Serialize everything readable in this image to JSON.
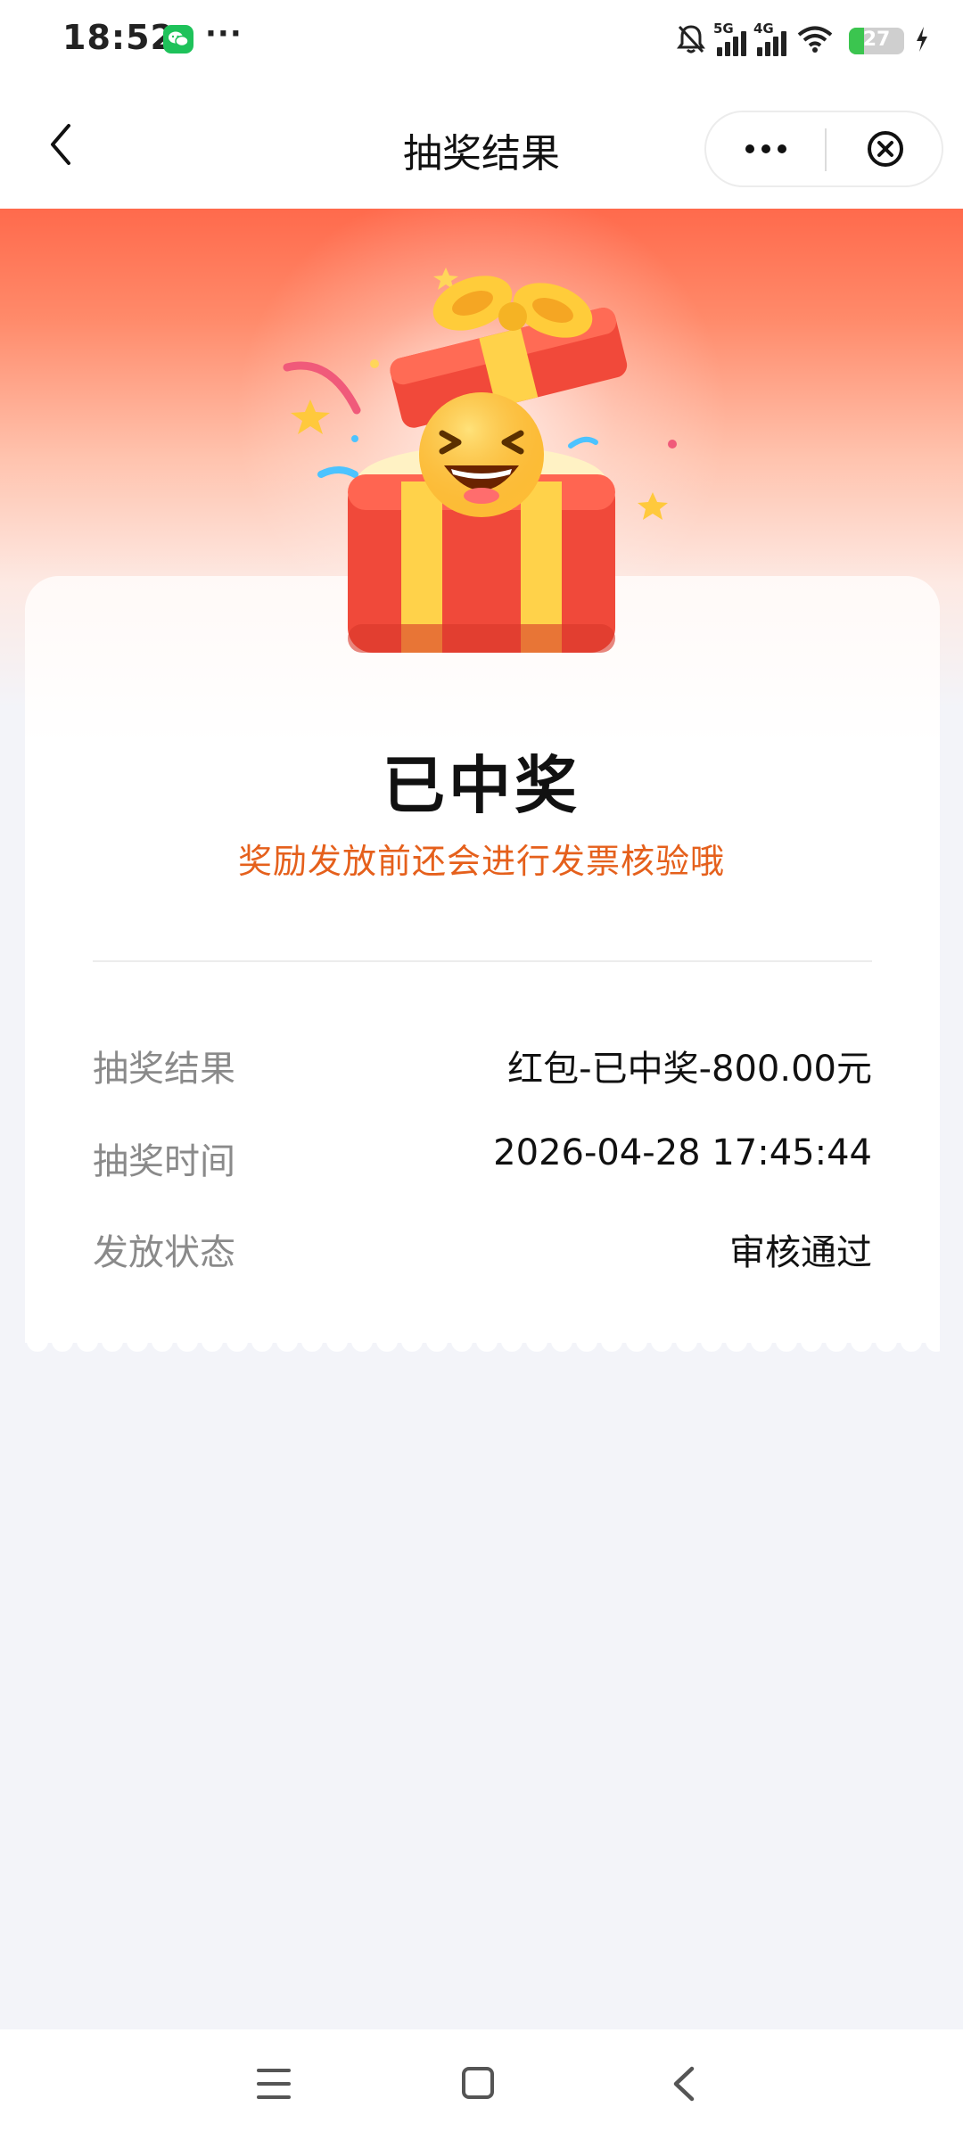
{
  "status_bar": {
    "time": "18:52",
    "more": "···",
    "signal_1_label": "5G",
    "signal_2_label": "4G",
    "battery": "27",
    "battery_level": 0.27,
    "icons": [
      "wechat-icon",
      "bell-off-icon",
      "signal-icon",
      "wifi-icon",
      "battery-icon",
      "charging-icon"
    ]
  },
  "nav": {
    "title": "抽奖结果",
    "back_icon": "chevron-left-icon",
    "more_icon": "more-dots-icon",
    "close_icon": "close-circle-icon"
  },
  "result": {
    "title": "已中奖",
    "subtitle": "奖励发放前还会进行发票核验哦",
    "image": "gift-box-emoji-illustration"
  },
  "details": [
    {
      "label": "抽奖结果",
      "value": "红包-已中奖-800.00元"
    },
    {
      "label": "抽奖时间",
      "value": "2026-04-28 17:45:44"
    },
    {
      "label": "发放状态",
      "value": "审核通过"
    }
  ],
  "system_nav": {
    "icons": [
      "menu-icon",
      "home-icon",
      "back-icon"
    ]
  },
  "colors": {
    "accent": "#e5601c",
    "hero_top": "#ff6a4c",
    "background": "#f3f4f9"
  }
}
